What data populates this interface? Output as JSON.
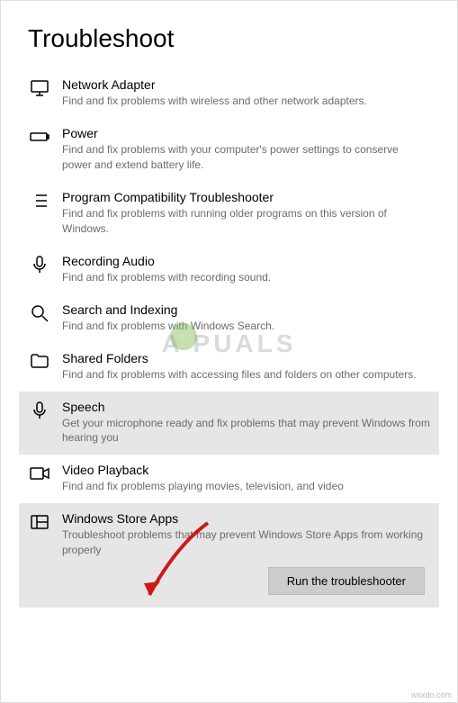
{
  "page_title": "Troubleshoot",
  "items": [
    {
      "title": "Network Adapter",
      "desc": "Find and fix problems with wireless and other network adapters."
    },
    {
      "title": "Power",
      "desc": "Find and fix problems with your computer's power settings to conserve power and extend battery life."
    },
    {
      "title": "Program Compatibility Troubleshooter",
      "desc": "Find and fix problems with running older programs on this version of Windows."
    },
    {
      "title": "Recording Audio",
      "desc": "Find and fix problems with recording sound."
    },
    {
      "title": "Search and Indexing",
      "desc": "Find and fix problems with Windows Search."
    },
    {
      "title": "Shared Folders",
      "desc": "Find and fix problems with accessing files and folders on other computers."
    },
    {
      "title": "Speech",
      "desc": "Get your microphone ready and fix problems that may prevent Windows from hearing you"
    },
    {
      "title": "Video Playback",
      "desc": "Find and fix problems playing movies, television, and video"
    },
    {
      "title": "Windows Store Apps",
      "desc": "Troubleshoot problems that may prevent Windows Store Apps from working properly"
    }
  ],
  "run_button": "Run the troubleshooter",
  "watermark": "A    PUALS",
  "credit": "wsxdn.com"
}
